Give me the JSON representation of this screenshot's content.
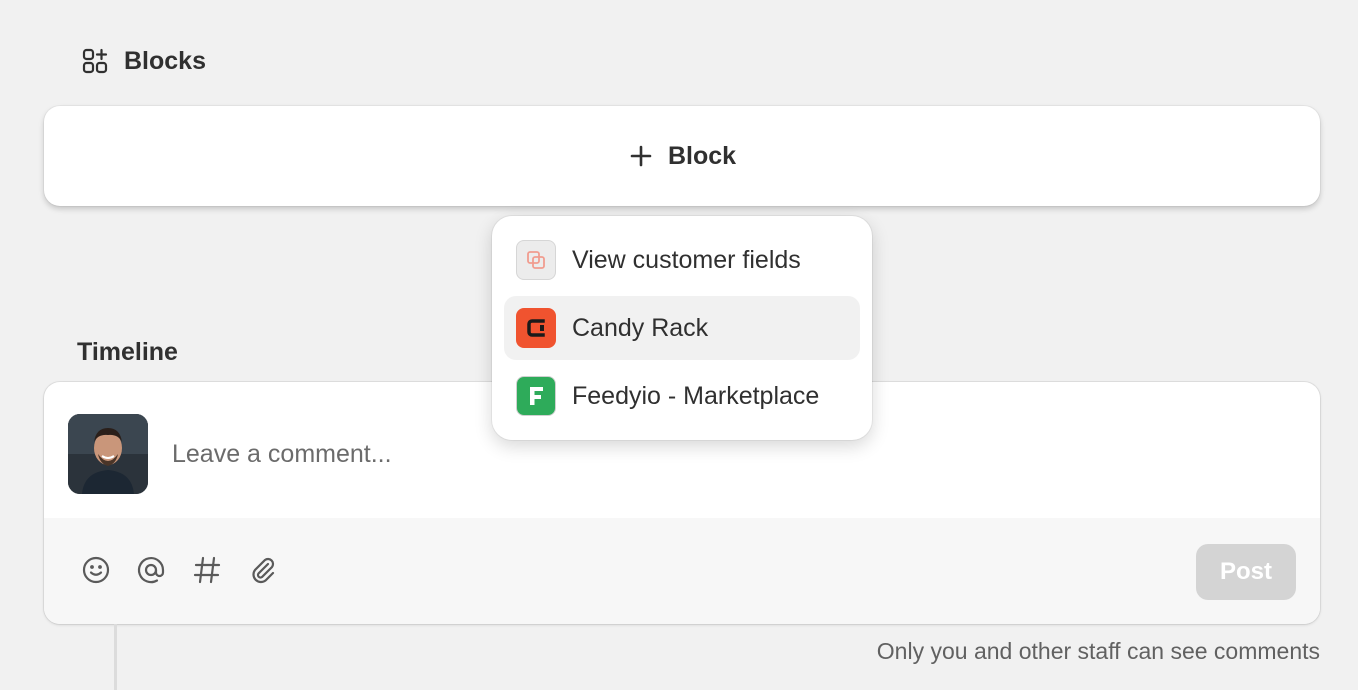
{
  "blocks": {
    "title": "Blocks",
    "add_block_label": "Block"
  },
  "timeline": {
    "title": "Timeline",
    "comment_placeholder": "Leave a comment...",
    "toolbar": [
      "emoji-icon",
      "mention-icon",
      "hashtag-icon",
      "attachment-icon"
    ],
    "post_label": "Post",
    "visibility_note": "Only you and other staff can see comments"
  },
  "menu": {
    "items": [
      {
        "label": "View customer fields",
        "icon": "customer-fields-icon",
        "color": "#e9e9e9"
      },
      {
        "label": "Candy Rack",
        "icon": "candy-rack-icon",
        "color": "#f0532f"
      },
      {
        "label": "Feedyio - Marketplace",
        "icon": "feedyio-icon",
        "color": "#2eab5a"
      }
    ],
    "highlighted_index": 1
  }
}
